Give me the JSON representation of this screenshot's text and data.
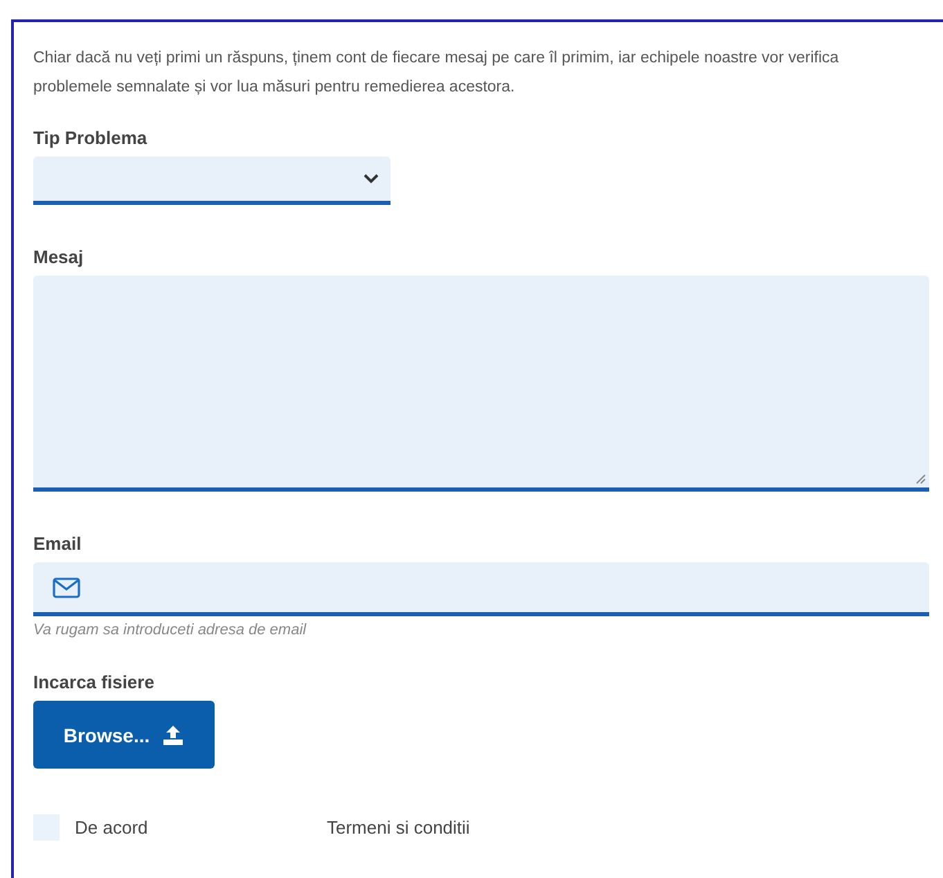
{
  "intro": "Chiar dacă nu veți primi un răspuns, ținem cont de fiecare mesaj pe care îl primim, iar echipele noastre vor verifica problemele semnalate și vor lua măsuri pentru remedierea acestora.",
  "problem_type": {
    "label": "Tip Problema"
  },
  "message": {
    "label": "Mesaj"
  },
  "email": {
    "label": "Email",
    "hint": "Va rugam sa introduceti adresa de email"
  },
  "upload": {
    "label": "Incarca fisiere",
    "button": "Browse..."
  },
  "agree": {
    "label": "De acord",
    "checked": false,
    "terms": "Termeni si conditii"
  }
}
